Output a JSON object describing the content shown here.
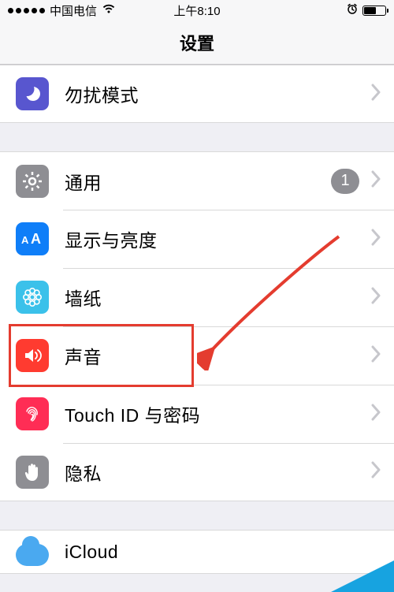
{
  "status": {
    "carrier": "中国电信",
    "time": "上午8:10"
  },
  "nav": {
    "title": "设置"
  },
  "group1": {
    "dnd": {
      "label": "勿扰模式"
    }
  },
  "group2": {
    "general": {
      "label": "通用",
      "badge": "1"
    },
    "display": {
      "label": "显示与亮度"
    },
    "wallpaper": {
      "label": "墙纸"
    },
    "sounds": {
      "label": "声音"
    },
    "touchid": {
      "label": "Touch ID 与密码"
    },
    "privacy": {
      "label": "隐私"
    }
  },
  "group3": {
    "icloud": {
      "label": "iCloud"
    }
  },
  "colors": {
    "purple": "#5856cf",
    "gray": "#8e8e93",
    "blue": "#0f7ef8",
    "cyan": "#3bc1ea",
    "red": "#ff3b30",
    "pinkred": "#ff2d55"
  }
}
